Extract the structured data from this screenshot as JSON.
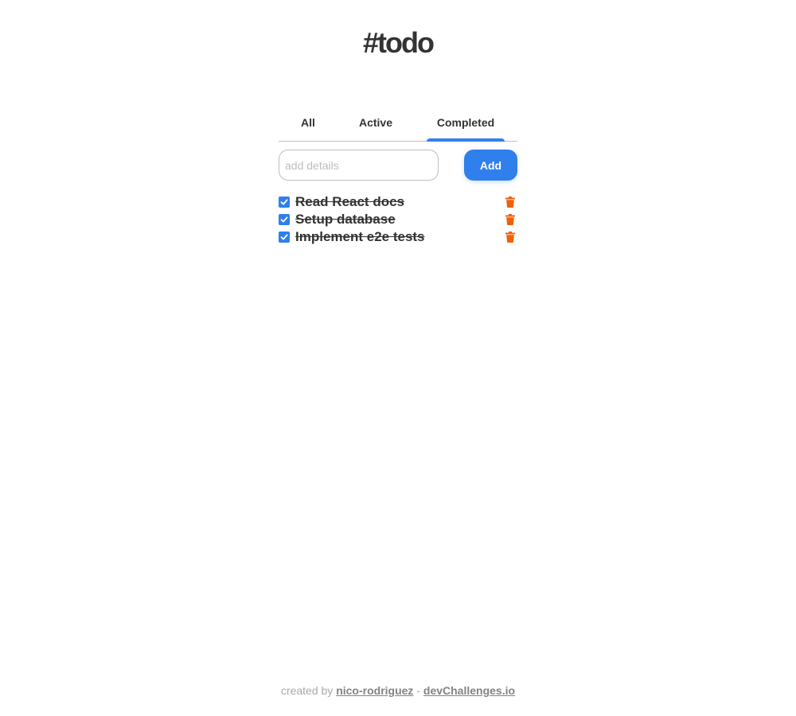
{
  "app": {
    "title": "#todo"
  },
  "tabs": [
    {
      "label": "All"
    },
    {
      "label": "Active"
    },
    {
      "label": "Completed",
      "selected": true
    }
  ],
  "add_form": {
    "placeholder": "add details",
    "value": "",
    "button_label": "Add"
  },
  "todos": [
    {
      "text": "Read React docs",
      "completed": true
    },
    {
      "text": "Setup database",
      "completed": true
    },
    {
      "text": "Implement e2e tests",
      "completed": true
    }
  ],
  "icons": {
    "checkbox": "check-icon",
    "delete": "trash-icon"
  },
  "colors": {
    "accent": "#2f80ed",
    "delete": "#eb5757",
    "text": "#333333"
  },
  "footer": {
    "prefix": "created by",
    "author": "nico-rodriguez",
    "separator": "-",
    "site": "devChallenges.io"
  }
}
